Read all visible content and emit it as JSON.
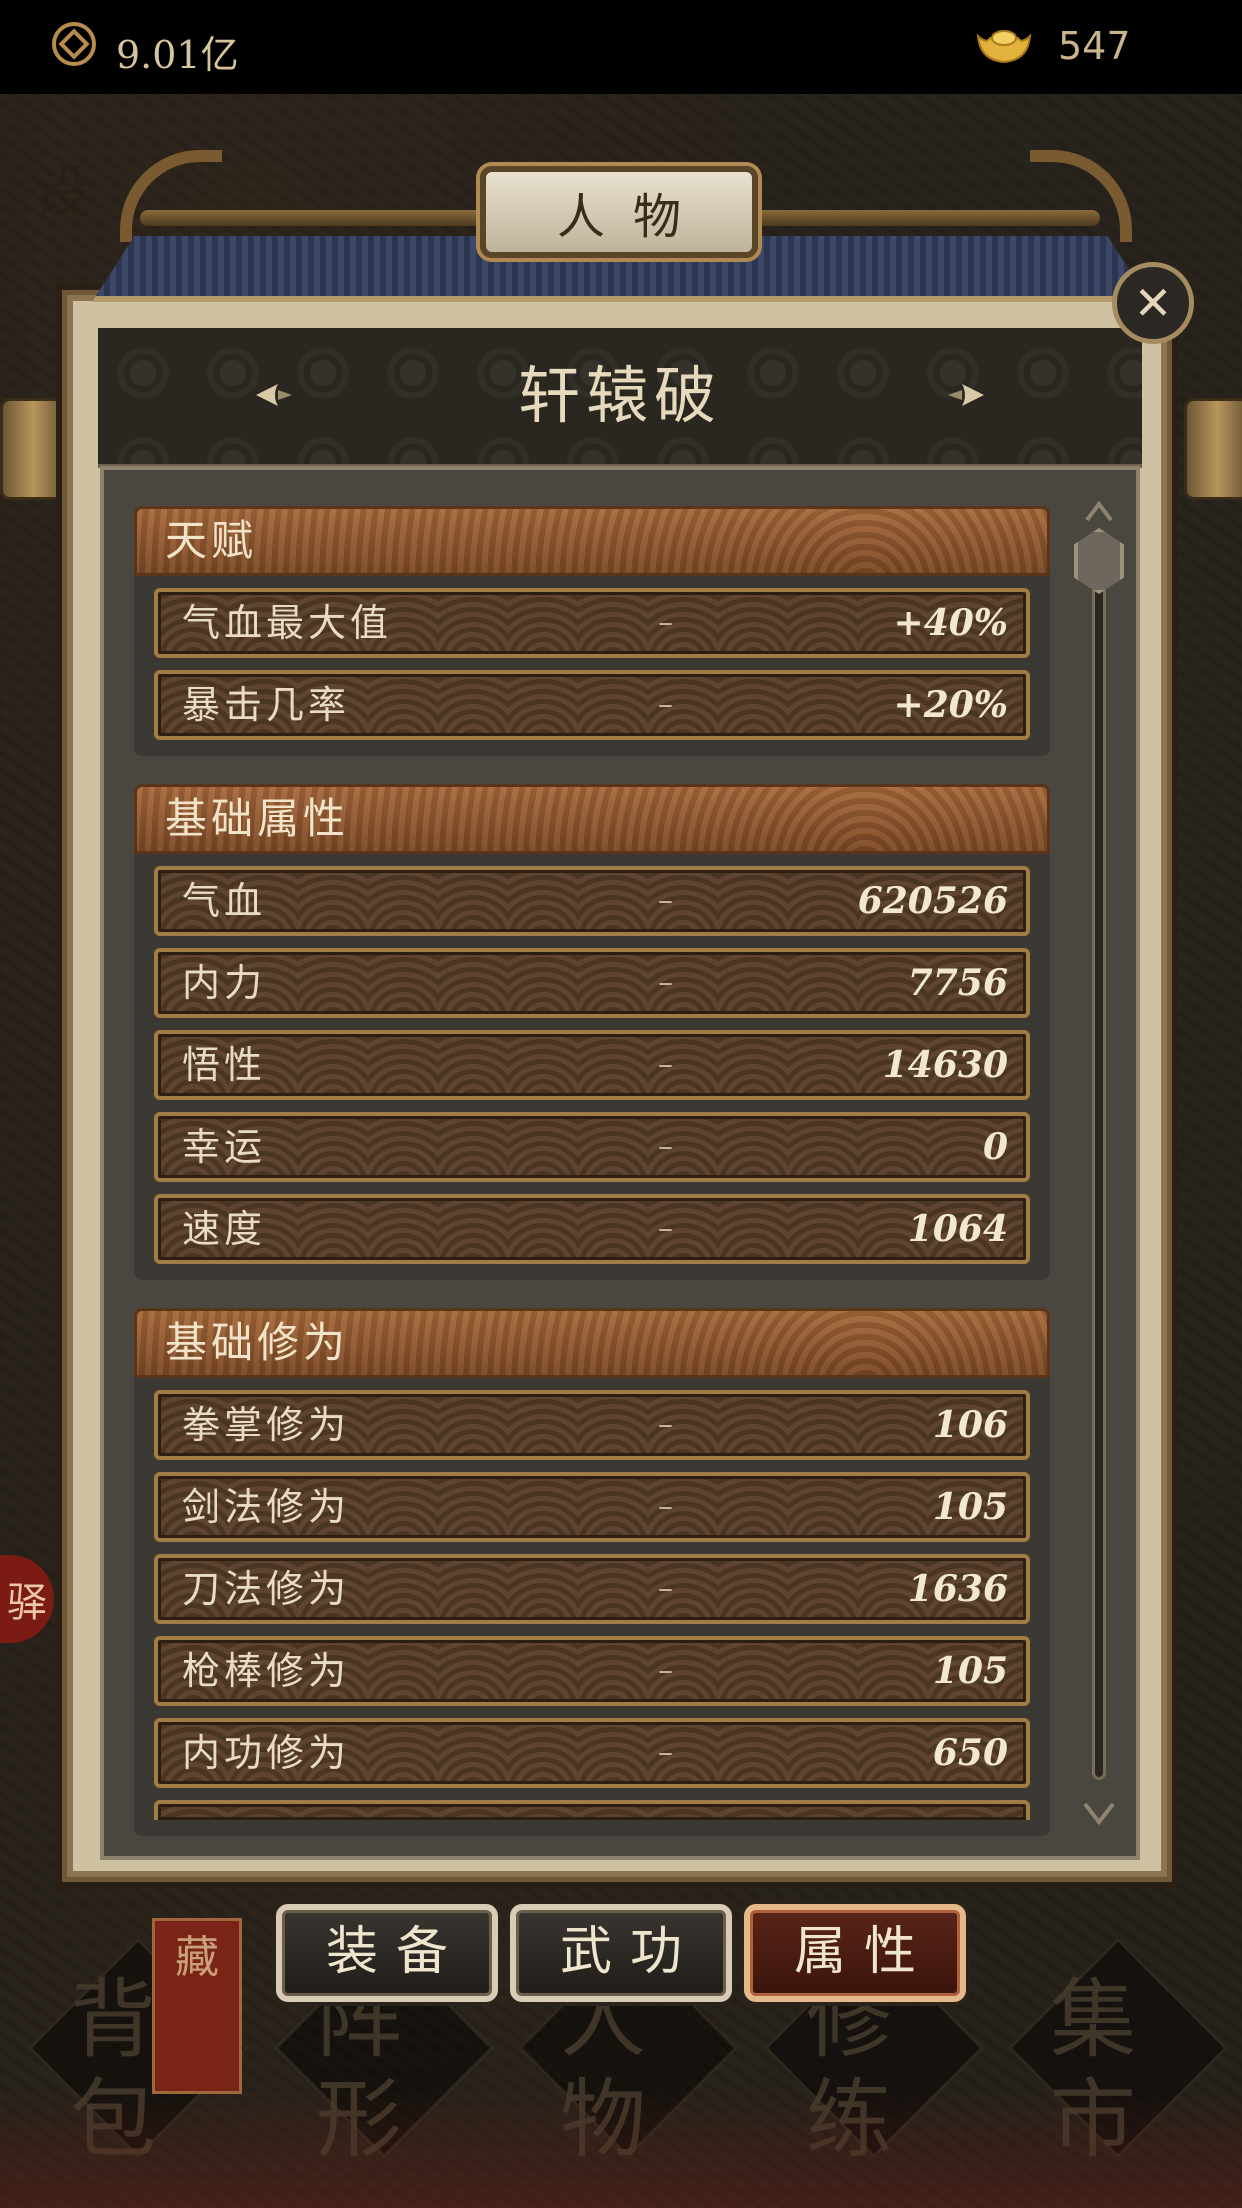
{
  "currency": {
    "coins": "9.01亿",
    "ingots": "547",
    "coin_icon": "coin-icon",
    "ingot_icon": "gold-ingot-icon"
  },
  "window_title": "人物",
  "character_name": "轩辕破",
  "side_chars": {
    "top_left": "设",
    "seal": "驿"
  },
  "sections": [
    {
      "title": "天赋",
      "rows": [
        {
          "label": "气血最大值",
          "sep": "–",
          "value": "+40%"
        },
        {
          "label": "暴击几率",
          "sep": "–",
          "value": "+20%"
        }
      ]
    },
    {
      "title": "基础属性",
      "rows": [
        {
          "label": "气血",
          "sep": "–",
          "value": "620526"
        },
        {
          "label": "内力",
          "sep": "–",
          "value": "7756"
        },
        {
          "label": "悟性",
          "sep": "–",
          "value": "14630"
        },
        {
          "label": "幸运",
          "sep": "–",
          "value": "0"
        },
        {
          "label": "速度",
          "sep": "–",
          "value": "1064"
        }
      ]
    },
    {
      "title": "基础修为",
      "rows": [
        {
          "label": "拳掌修为",
          "sep": "–",
          "value": "106"
        },
        {
          "label": "剑法修为",
          "sep": "–",
          "value": "105"
        },
        {
          "label": "刀法修为",
          "sep": "–",
          "value": "1636"
        },
        {
          "label": "枪棒修为",
          "sep": "–",
          "value": "105"
        },
        {
          "label": "内功修为",
          "sep": "–",
          "value": "650"
        }
      ]
    }
  ],
  "tabs": [
    {
      "label": "装备",
      "active": false
    },
    {
      "label": "武功",
      "active": false
    },
    {
      "label": "属性",
      "active": true
    }
  ],
  "bottom_nav": [
    {
      "label": "背包"
    },
    {
      "label": "阵形"
    },
    {
      "label": "人物"
    },
    {
      "label": "修练"
    },
    {
      "label": "集市"
    }
  ],
  "cang_tag": "藏",
  "colors": {
    "accent": "#a86a3c",
    "panel": "#4a4640",
    "active_tab": "#5a2418"
  }
}
